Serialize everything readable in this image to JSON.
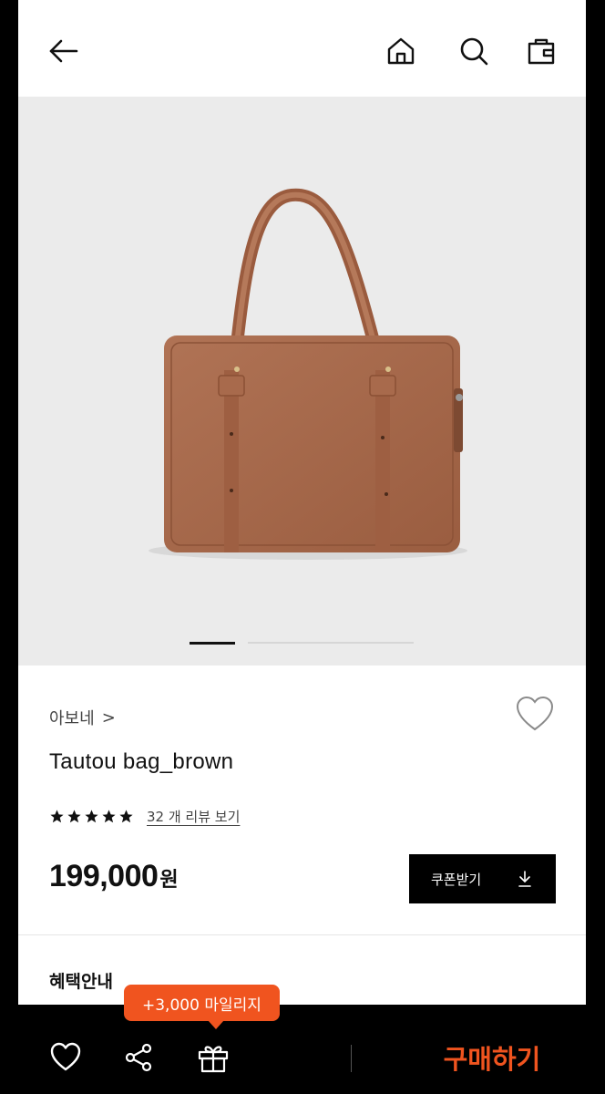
{
  "header": {
    "back_icon": "arrow-left-icon",
    "home_icon": "home-icon",
    "search_icon": "search-icon",
    "cart_icon": "shopping-bag-icon"
  },
  "gallery": {
    "background": "#ebebeb",
    "bag_color": "#a8694a",
    "current_slide": 1
  },
  "product": {
    "brand": "아보네",
    "brand_chevron": ">",
    "title": "Tautou bag_brown",
    "rating_stars": 5,
    "review_link": "32 개 리뷰 보기",
    "price": "199,000",
    "price_unit": "원",
    "coupon_label": "쿠폰받기"
  },
  "benefit": {
    "heading": "혜택안내"
  },
  "tooltip": {
    "text": "+3,000 마일리지",
    "color": "#f0541f"
  },
  "bottom_bar": {
    "buy_label": "구매하기",
    "accent": "#f0541f"
  }
}
